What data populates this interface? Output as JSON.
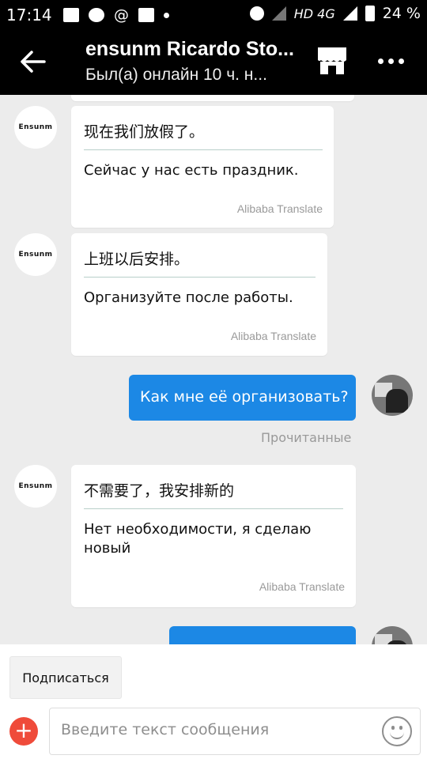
{
  "status_bar": {
    "time": "17:14",
    "network": "HD 4G",
    "battery": "24 %"
  },
  "header": {
    "title": "ensunm Ricardo Sto...",
    "subtitle": "Был(а) онлайн 10 ч. н..."
  },
  "avatar": {
    "logo_text": "Ensunm"
  },
  "messages": [
    {
      "original": "现在我们放假了。",
      "translation": "Сейчас у нас есть праздник.",
      "tag": "Alibaba Translate"
    },
    {
      "original": "上班以后安排。",
      "translation": "Организуйте после работы.",
      "tag": "Alibaba Translate"
    },
    {
      "outgoing": "Как мне её организовать?",
      "status": "Прочитанные"
    },
    {
      "original": "不需要了，我安排新的",
      "translation": "Нет необходимости, я сделаю новый",
      "tag": "Alibaba Translate"
    }
  ],
  "bottom": {
    "subscribe_label": "Подписаться",
    "input_placeholder": "Введите текст сообщения"
  }
}
